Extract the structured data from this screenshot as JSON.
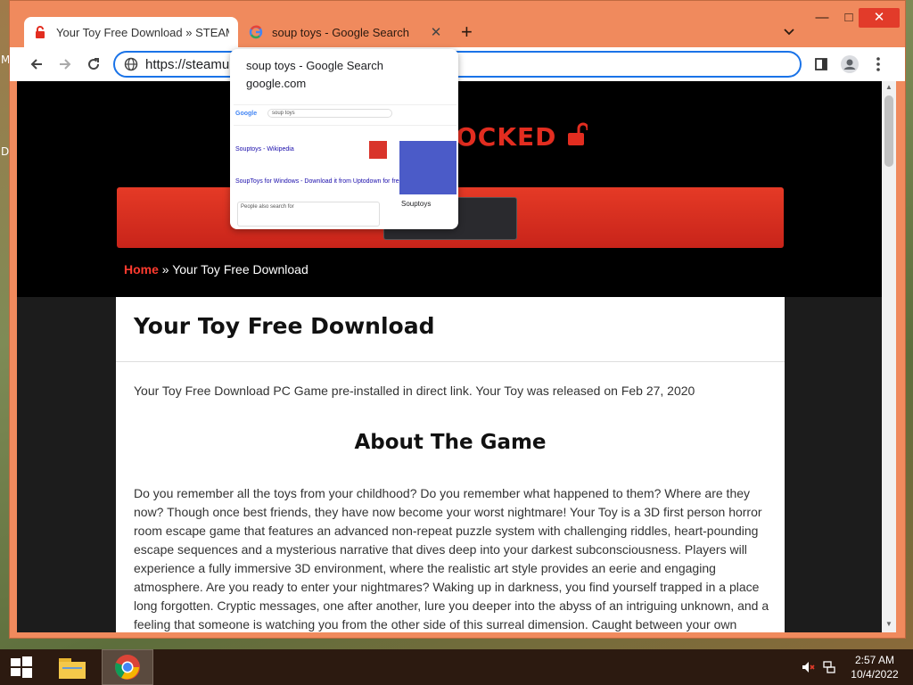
{
  "desktop": {
    "edge_letters": [
      "M",
      "D"
    ]
  },
  "browser": {
    "tabs": [
      {
        "title": "Your Toy Free Download » STEAM",
        "favicon": "lock-icon",
        "active": true
      },
      {
        "title": "soup toys - Google Search",
        "favicon": "google-g-icon",
        "active": false
      }
    ],
    "new_tab_label": "+",
    "window_controls": {
      "minimize": "—",
      "maximize": "□",
      "close": "✕"
    },
    "address": "https://steamun",
    "hover_card": {
      "title": "soup toys - Google Search",
      "domain": "google.com",
      "thumb": {
        "query": "soup toys",
        "result1_title": "Souptoys - Wikipedia",
        "result2_title": "SoupToys for Windows - Download it from Uptodown for free",
        "panel_title": "Souptoys",
        "paa_label": "People also search for"
      }
    }
  },
  "page": {
    "logo_text": "OCKED",
    "breadcrumb": {
      "home": "Home",
      "separator": " » ",
      "current": "Your Toy Free Download"
    },
    "article": {
      "title": "Your Toy Free Download",
      "intro": "Your Toy Free Download PC Game pre-installed in direct link. Your Toy was released on Feb 27, 2020",
      "section_heading": "About The Game",
      "description": "Do you remember all the toys from your childhood? Do you remember what happened to them? Where are they now? Though once best friends, they have now become your worst nightmare! Your Toy is a 3D first person horror room escape game that features an advanced non-repeat puzzle system with challenging riddles, heart-pounding escape sequences and a mysterious narrative that dives deep into your darkest subconsciousness. Players will experience a fully immersive 3D environment, where the realistic art style provides an eerie and engaging atmosphere. Are you ready to enter your nightmares?  Waking up in darkness, you find yourself trapped in a place long forgotten. Cryptic messages, one after another, lure you deeper into the abyss of an intriguing unknown, and a feeling that someone is watching you from the other side of this surreal dimension. Caught between your own"
    }
  },
  "taskbar": {
    "time": "2:57 AM",
    "date": "10/4/2022"
  },
  "colors": {
    "titlebar": "#f08a5d",
    "accent_red": "#e22d20",
    "link_blue": "#1a73e8",
    "taskbar": "#2c1a10"
  }
}
